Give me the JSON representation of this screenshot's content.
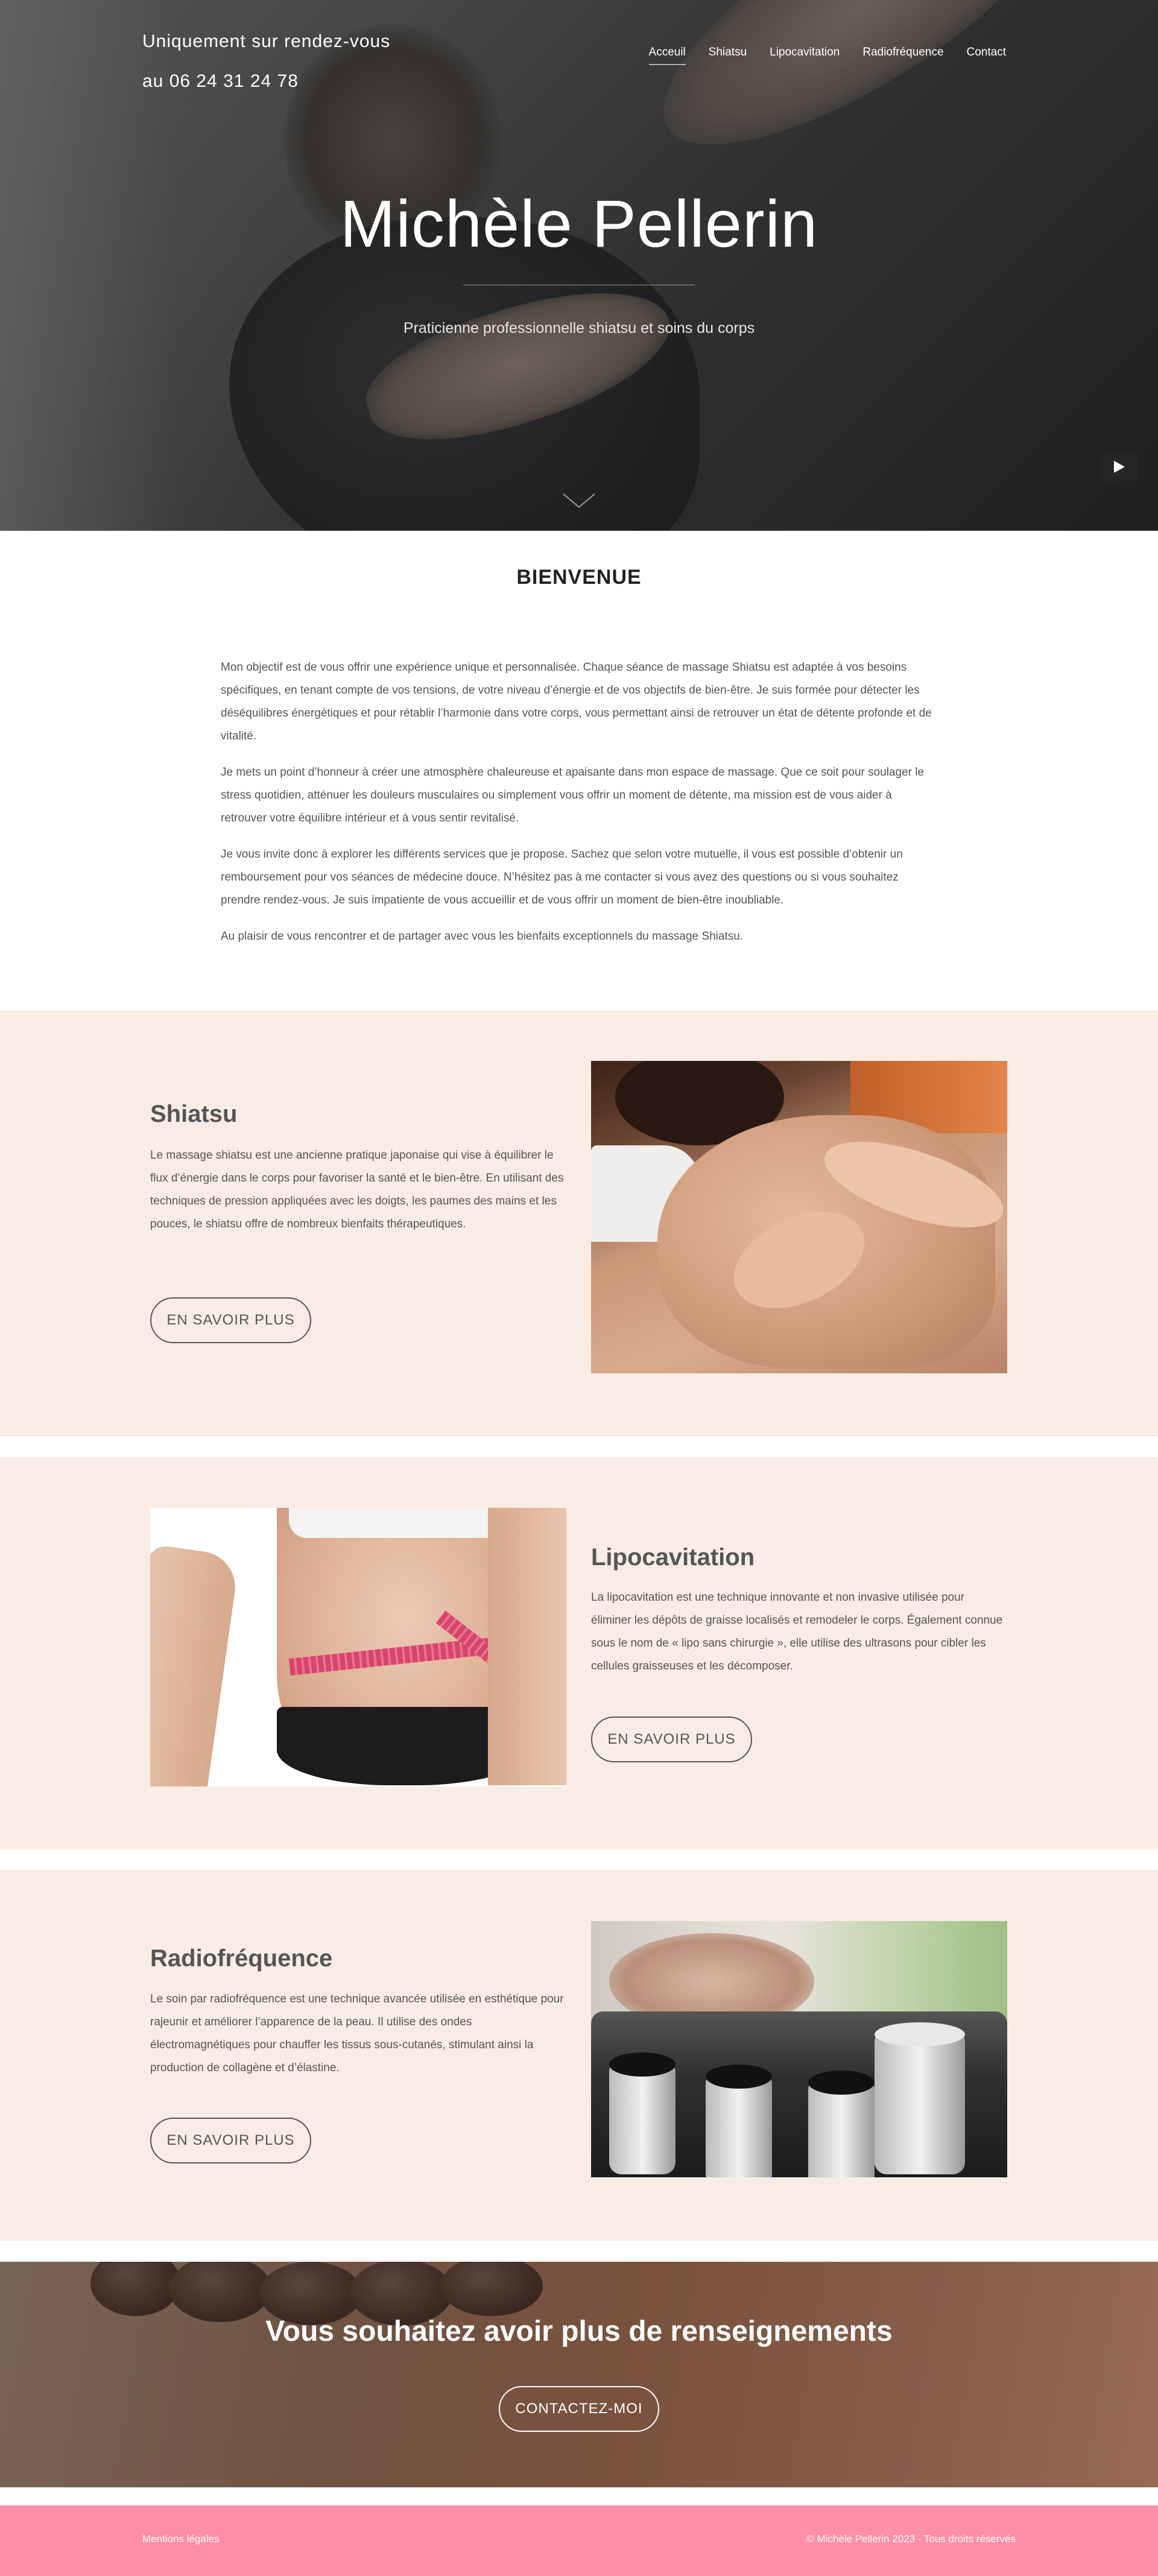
{
  "header": {
    "appointment_line": "Uniquement sur rendez-vous",
    "phone_line": "au 06 24 31 24 78",
    "nav": [
      {
        "label": "Acceuil",
        "active": true
      },
      {
        "label": "Shiatsu",
        "active": false
      },
      {
        "label": "Lipocavitation",
        "active": false
      },
      {
        "label": "Radiofréquence",
        "active": false
      },
      {
        "label": "Contact",
        "active": false
      }
    ]
  },
  "hero": {
    "title": "Michèle Pellerin",
    "subtitle": "Praticienne professionnelle shiatsu et soins du corps",
    "scroll_icon": "chevron-down-icon",
    "play_icon": "play-icon"
  },
  "welcome": {
    "title": "BIENVENUE",
    "paragraphs": [
      "Mon objectif est de vous offrir une expérience unique et personnalisée. Chaque séance de massage Shiatsu est adaptée à vos besoins spécifiques, en tenant compte de vos tensions, de votre niveau d’énergie et de vos objectifs de bien-être. Je suis formée pour détecter les déséquilibres énergétiques et pour rétablir l’harmonie dans votre corps, vous permettant ainsi de retrouver un état de détente profonde et de vitalité.",
      "Je mets un point d’honneur à créer une atmosphère chaleureuse et apaisante dans mon espace de massage. Que ce soit pour soulager le stress quotidien, atténuer les douleurs musculaires ou simplement vous offrir un moment de détente, ma mission est de vous aider à retrouver votre équilibre intérieur et à vous sentir revitalisé.",
      "Je vous invite donc à explorer les différents services que je propose. Sachez que selon votre mutuelle, il vous est possible d’obtenir un remboursement pour vos séances de médecine douce. N’hésitez pas à me contacter si vous avez des questions ou si vous souhaitez prendre rendez-vous. Je suis impatiente de vous accueillir et de vous offrir un moment de bien-être inoubliable.",
      "Au plaisir de vous rencontrer et de partager avec vous les bienfaits exceptionnels du massage Shiatsu."
    ]
  },
  "services": [
    {
      "title": "Shiatsu",
      "text": "Le massage shiatsu est une ancienne pratique japonaise qui vise à équilibrer le flux d’énergie dans le corps pour favoriser la santé et le bien-être. En utilisant des techniques de pression appliquées avec les doigts, les paumes des mains et les pouces, le shiatsu offre de nombreux bienfaits thérapeutiques.",
      "button": "EN SAVOIR PLUS"
    },
    {
      "title": "Lipocavitation",
      "text": "La lipocavitation est une technique innovante et non invasive utilisée pour éliminer les dépôts de graisse localisés et remodeler le corps. Également connue sous le nom de « lipo sans chirurgie », elle utilise des ultrasons pour cibler les cellules graisseuses et les décomposer.",
      "button": "EN SAVOIR PLUS"
    },
    {
      "title": "Radiofréquence",
      "text": "Le soin par radiofréquence est une technique avancée utilisée en esthétique pour rajeunir et améliorer l’apparence de la peau. Il utilise des ondes électromagnétiques pour chauffer les tissus sous-cutanés, stimulant ainsi la production de collagène et d’élastine.",
      "button": "EN SAVOIR PLUS"
    }
  ],
  "cta": {
    "title": "Vous souhaitez avoir plus de renseignements",
    "button": "CONTACTEZ-MOI"
  },
  "footer": {
    "legal": "Mentions légales",
    "copyright": "© Michèle Pellerin 2023 - Tous droits réservés"
  },
  "colors": {
    "section_bg": "#f9ece4",
    "footer_bg": "#ff8fa7",
    "text": "#555555"
  }
}
